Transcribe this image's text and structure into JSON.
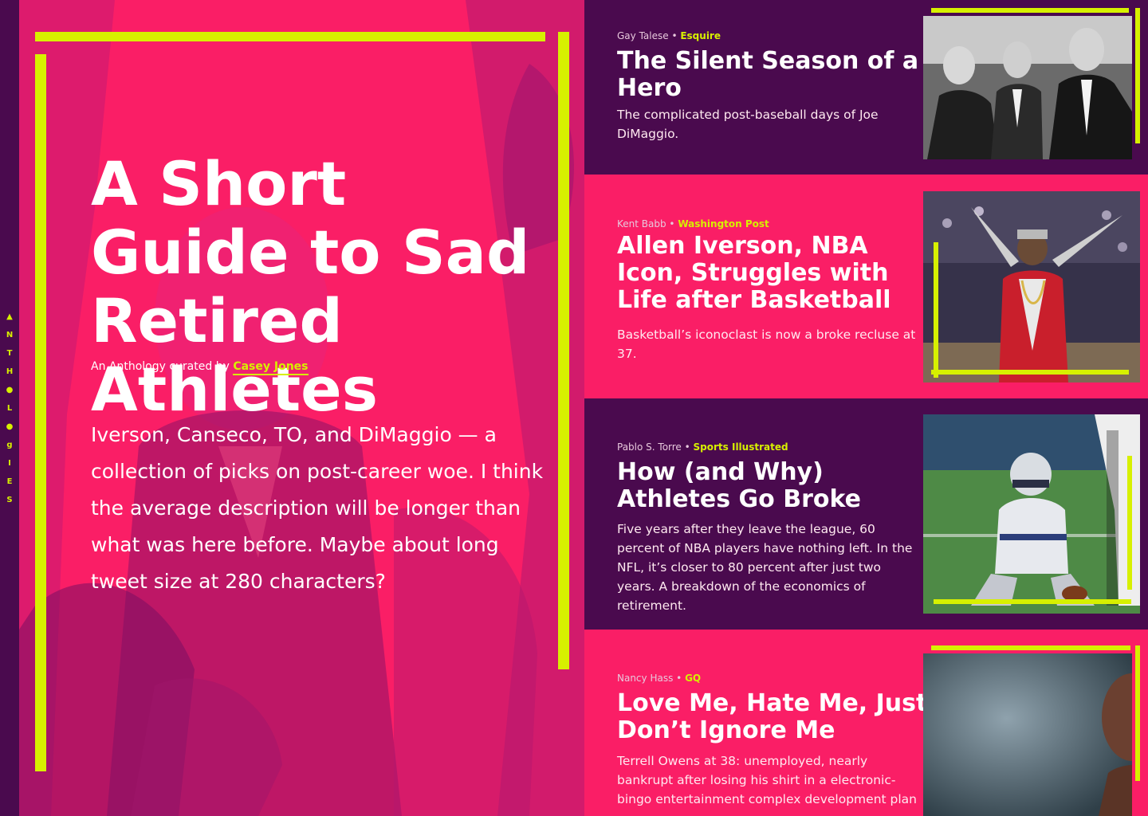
{
  "side_nav": {
    "letters": [
      "▲",
      "N",
      "T",
      "H",
      "●",
      "L",
      "●",
      "g",
      "I",
      "E",
      "S"
    ]
  },
  "hero": {
    "title": "A Short Guide to Sad Retired Athletes",
    "byline_prefix": "An Anthology curated by",
    "curator": "Casey Jones",
    "description": "Iverson, Canseco, TO, and DiMaggio — a collection of picks on post-career woe. I think the average description will be longer than what was here before. Maybe about long tweet size at 280 characters?"
  },
  "articles": [
    {
      "author": "Gay Talese",
      "publication": "Esquire",
      "title": "The Silent Season of a Hero",
      "description": "The complicated post-baseball days of Joe DiMaggio."
    },
    {
      "author": "Kent Babb",
      "publication": "Washington Post",
      "title": "Allen Iverson, NBA Icon, Struggles with Life after Basketball",
      "description": "Basketball’s iconoclast is now a broke recluse at 37."
    },
    {
      "author": "Pablo S. Torre",
      "publication": "Sports Illustrated",
      "title": "How (and Why) Athletes Go Broke",
      "description": "Five years after they leave the league, 60 percent of NBA players have nothing left. In the NFL, it’s closer to 80 percent after just two years. A breakdown of the economics of retirement."
    },
    {
      "author": "Nancy Hass",
      "publication": "GQ",
      "title": "Love Me, Hate Me, Just Don’t Ignore Me",
      "description": "Terrell Owens at 38: unemployed, nearly bankrupt after losing his shirt in a electronic-bingo entertainment complex development plan"
    }
  ],
  "colors": {
    "pink": "#fa1e66",
    "purple": "#4a0a4e",
    "accent": "#d7f000"
  }
}
